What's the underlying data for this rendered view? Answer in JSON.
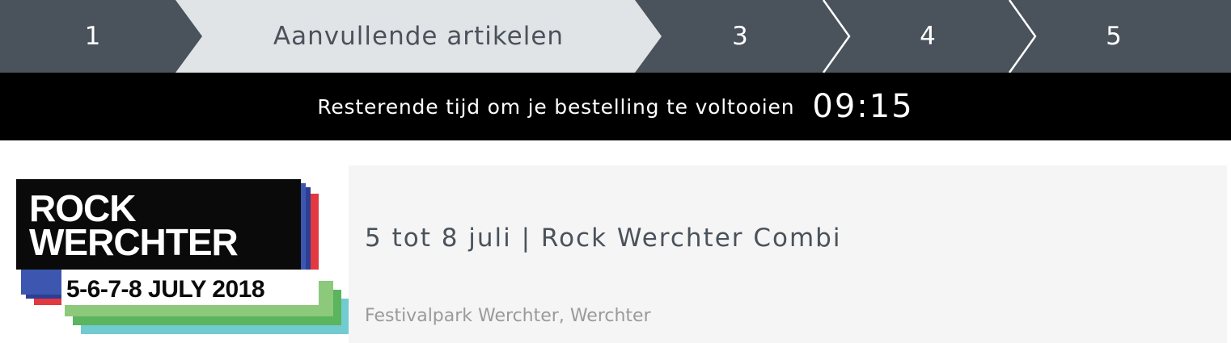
{
  "steps": [
    {
      "label": "1",
      "active": false
    },
    {
      "label": "Aanvullende artikelen",
      "active": true
    },
    {
      "label": "3",
      "active": false
    },
    {
      "label": "4",
      "active": false
    },
    {
      "label": "5",
      "active": false
    }
  ],
  "timer": {
    "text": "Resterende tijd om je bestelling te voltooien",
    "value": "09:15"
  },
  "event": {
    "title": "5 tot 8 juli | Rock Werchter Combi",
    "venue": "Festivalpark Werchter, Werchter",
    "logo": {
      "line1": "ROCK",
      "line2": "WERCHTER",
      "dates": "5-6-7-8 JULY 2018"
    }
  },
  "colors": {
    "step_bg": "#4a525b",
    "step_active_bg": "#e1e4e7",
    "timer_bg": "#000000",
    "panel_bg": "#f5f5f5",
    "logo_red": "#e2383f",
    "logo_blue": "#2d3e94",
    "logo_green": "#5ab55e",
    "logo_teal": "#72cbd0"
  }
}
